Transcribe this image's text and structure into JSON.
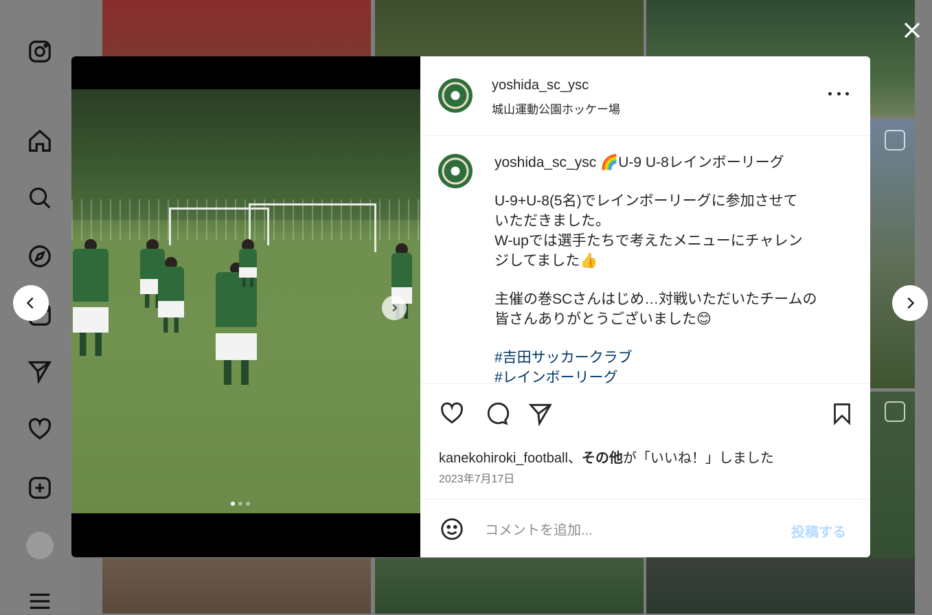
{
  "post": {
    "username": "yoshida_sc_ysc",
    "location": "城山運動公園ホッケー場",
    "caption_title": "🌈U-9 U-8レインボーリーグ",
    "caption_lines": [
      "U-9+U-8(5名)でレインボーリーグに参加させて",
      "いただきました。",
      "W-upでは選手たちで考えたメニューにチャレン",
      "ジしてました👍",
      "主催の巻SCさんはじめ…対戦いただいたチームの",
      "皆さんありがとうございました😊"
    ],
    "hashtags": [
      "#吉田サッカークラブ",
      "#レインボーリーグ"
    ],
    "likes_user": "kanekohiroki_football",
    "likes_joiner": "、",
    "likes_others": "その他",
    "likes_suffix": "が「いいね！」しました",
    "date": "2023年7月17日",
    "comment_placeholder": "コメントを追加...",
    "post_button": "投稿する"
  },
  "icons": {
    "nav": [
      "instagram-icon",
      "home-icon",
      "search-icon",
      "explore-icon",
      "reels-icon",
      "send-icon",
      "heart-icon",
      "create-icon",
      "profile-avatar",
      "menu-icon"
    ],
    "actions": [
      "like-icon",
      "comment-icon",
      "share-icon",
      "save-icon"
    ]
  },
  "carousel": {
    "total": 3,
    "current": 1
  },
  "colors": {
    "hashtag": "#00376b",
    "post_button": "#b3dbff",
    "club_green": "#2f6d3b"
  }
}
